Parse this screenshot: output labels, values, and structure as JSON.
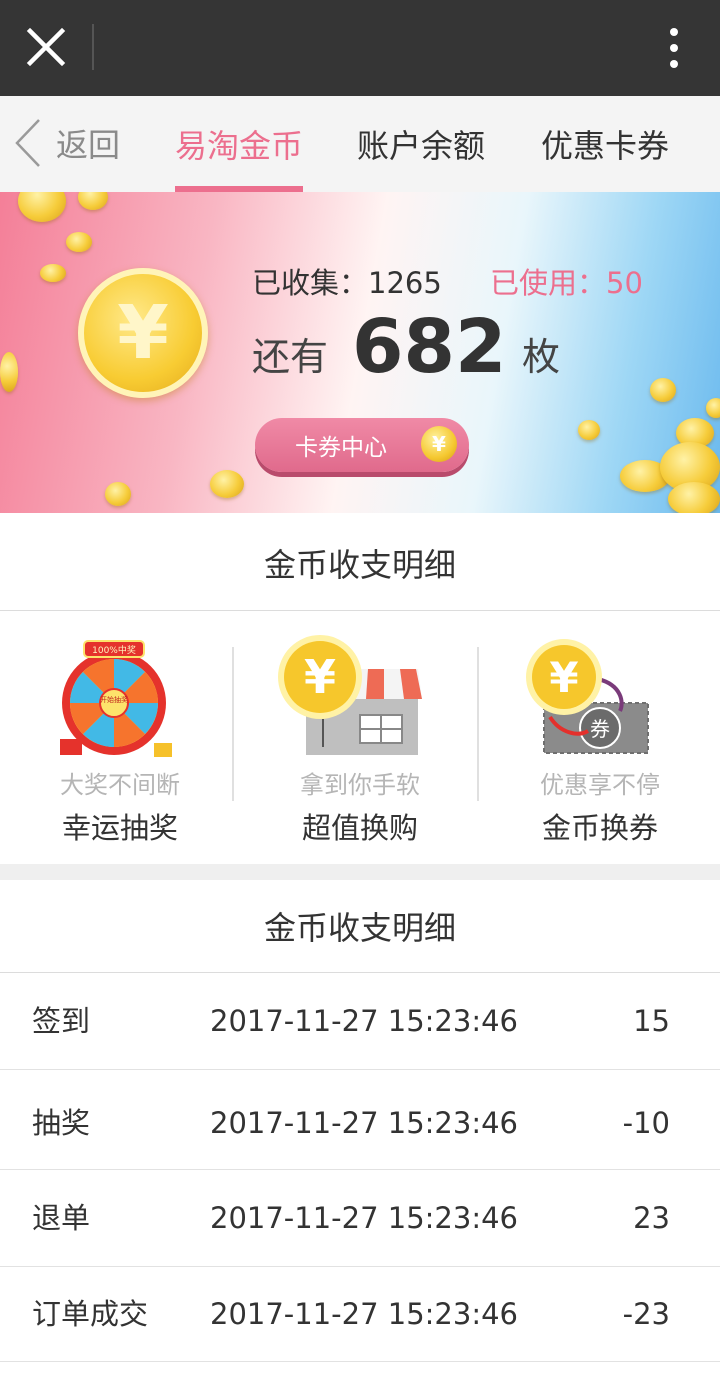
{
  "topbar": {
    "close_icon": "close-icon",
    "more_icon": "more-vertical-icon"
  },
  "nav": {
    "back_label": "返回",
    "tabs": [
      {
        "label": "易淘金币",
        "active": true
      },
      {
        "label": "账户余额",
        "active": false
      },
      {
        "label": "优惠卡券",
        "active": false
      }
    ]
  },
  "banner": {
    "coin_symbol": "¥",
    "collected": "已收集：1265",
    "used": "已使用：50",
    "remain_prefix": "还有",
    "remain_value": "682",
    "remain_unit": "枚",
    "coupon_button": "卡券中心",
    "accent_color": "#ec6f8e"
  },
  "section1_title": "金币收支明细",
  "features": [
    {
      "subtitle": "大奖不间断",
      "title": "幸运抽奖",
      "icon": "lucky-wheel-icon",
      "wheel_banner": "100%中奖",
      "wheel_center": "开始抽奖"
    },
    {
      "subtitle": "拿到你手软",
      "title": "超值换购",
      "icon": "coin-shop-icon",
      "coin_symbol": "¥"
    },
    {
      "subtitle": "优惠享不停",
      "title": "金币换券",
      "icon": "coin-coupon-icon",
      "coin_symbol": "¥",
      "coupon_char": "券"
    }
  ],
  "section2_title": "金币收支明细",
  "records": [
    {
      "type": "签到",
      "time": "2017-11-27 15:23:46",
      "amount": "15"
    },
    {
      "type": "抽奖",
      "time": "2017-11-27 15:23:46",
      "amount": "-10"
    },
    {
      "type": "退单",
      "time": "2017-11-27 15:23:46",
      "amount": "23"
    },
    {
      "type": "订单成交",
      "time": "2017-11-27 15:23:46",
      "amount": "-23"
    }
  ]
}
